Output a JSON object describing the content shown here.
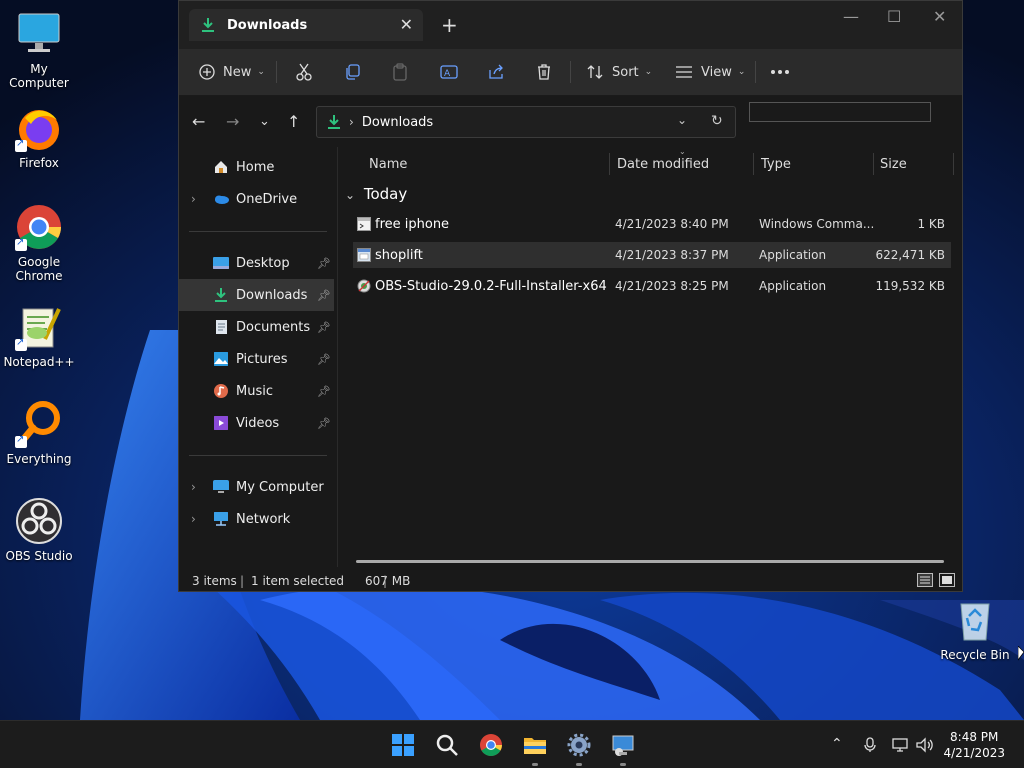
{
  "desktop": {
    "icons": [
      {
        "label": "My Computer",
        "icon": "monitor-icon"
      },
      {
        "label": "Firefox",
        "icon": "firefox-icon"
      },
      {
        "label": "Google\nChrome",
        "icon": "chrome-icon"
      },
      {
        "label": "Notepad++",
        "icon": "notepad-plus-plus-icon"
      },
      {
        "label": "Everything",
        "icon": "everything-search-icon"
      },
      {
        "label": "OBS Studio",
        "icon": "obs-icon"
      },
      {
        "label": "Recycle Bin",
        "icon": "recycle-bin-icon"
      }
    ]
  },
  "window": {
    "tab_title": "Downloads",
    "toolbar": {
      "new_label": "New",
      "sort_label": "Sort",
      "view_label": "View"
    },
    "address": {
      "path": "Downloads"
    },
    "sidebar": {
      "items": [
        {
          "label": "Home",
          "icon": "home-icon"
        },
        {
          "label": "OneDrive",
          "icon": "onedrive-icon"
        },
        {
          "label": "Desktop",
          "icon": "desktop-folder-icon"
        },
        {
          "label": "Downloads",
          "icon": "downloads-icon"
        },
        {
          "label": "Documents",
          "icon": "documents-icon"
        },
        {
          "label": "Pictures",
          "icon": "pictures-icon"
        },
        {
          "label": "Music",
          "icon": "music-icon"
        },
        {
          "label": "Videos",
          "icon": "videos-icon"
        },
        {
          "label": "My Computer",
          "icon": "computer-icon"
        },
        {
          "label": "Network",
          "icon": "network-icon"
        }
      ]
    },
    "columns": {
      "name": "Name",
      "date": "Date modified",
      "type": "Type",
      "size": "Size"
    },
    "group": "Today",
    "files": [
      {
        "name": "free iphone",
        "date": "4/21/2023 8:40 PM",
        "type": "Windows Comma...",
        "size": "1 KB"
      },
      {
        "name": "shoplift",
        "date": "4/21/2023 8:37 PM",
        "type": "Application",
        "size": "622,471 KB"
      },
      {
        "name": "OBS-Studio-29.0.2-Full-Installer-x64",
        "date": "4/21/2023 8:25 PM",
        "type": "Application",
        "size": "119,532 KB"
      }
    ],
    "status": {
      "count": "3 items",
      "selected": "1 item selected",
      "size": "607 MB"
    }
  },
  "taskbar": {
    "time": "8:48 PM",
    "date": "4/21/2023"
  },
  "colors": {
    "accent": "#0078d4",
    "window_bg": "#191919",
    "toolbar_bg": "#2b2b2b"
  }
}
